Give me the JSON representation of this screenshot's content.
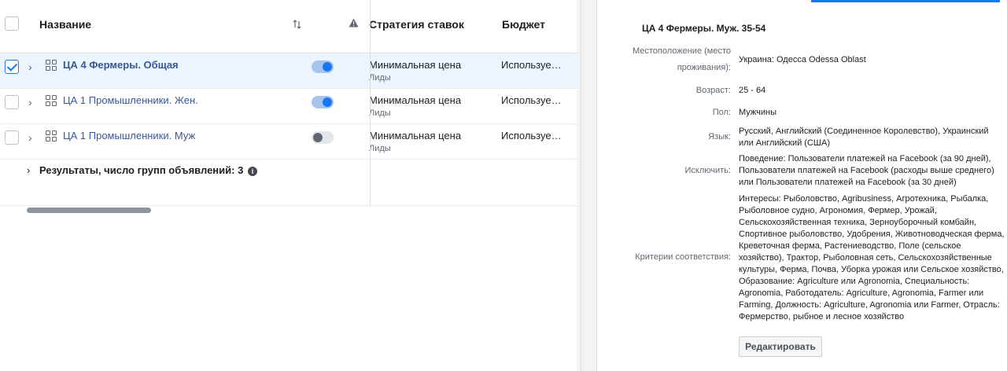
{
  "table": {
    "headers": {
      "name": "Название",
      "strategy": "Стратегия ставок",
      "budget": "Бюджет"
    },
    "rows": [
      {
        "name": "ЦА 4 Фермеры. Общая",
        "toggle_on": true,
        "strategy": "Минимальная цена",
        "strategy_sub": "Лиды",
        "budget": "Используе…",
        "selected": true
      },
      {
        "name": "ЦА 1 Промышленники. Жен.",
        "toggle_on": true,
        "strategy": "Минимальная цена",
        "strategy_sub": "Лиды",
        "budget": "Используе…",
        "selected": false
      },
      {
        "name": "ЦА 1 Промышленники. Муж",
        "toggle_on": false,
        "strategy": "Минимальная цена",
        "strategy_sub": "Лиды",
        "budget": "Используе…",
        "selected": false
      }
    ],
    "summary": "Результаты, число групп объявлений: 3"
  },
  "icons": {
    "sort": "sort-arrows-icon",
    "warning": "warning-icon",
    "expand": "chevron-right-icon",
    "adset": "grid-icon",
    "info": "info-icon"
  },
  "colors": {
    "accent": "#1877f2",
    "link": "#385898",
    "selected_row": "#ebf5ff"
  },
  "audience": {
    "title": "ЦА 4 Фермеры. Муж. 35-54",
    "location_label_1": "Местоположение (место",
    "location_label_2": "проживания):",
    "location_value": "Украина: Одесса Odessa Oblast",
    "age_label": "Возраст:",
    "age_value": "25 - 64",
    "gender_label": "Пол:",
    "gender_value": "Мужчины",
    "language_label": "Язык:",
    "language_value": "Русский, Английский (Соединенное Королевство), Украинский или Английский (США)",
    "exclude_label": "Исключить:",
    "exclude_value": "Поведение: Пользователи платежей на Facebook (за 90 дней), Пользователи платежей на Facebook (расходы выше среднего) или Пользователи платежей на Facebook (за 30 дней)",
    "criteria_label": "Критерии соответствия:",
    "criteria_value": "Интересы: Рыболовство, Agribusiness, Агротехника, Рыбалка, Рыболовное судно, Агрономия, Фермер, Урожай, Сельскохозяйственная техника, Зерноуборочный комбайн, Спортивное рыболовство, Удобрения, Животноводческая ферма, Креветочная ферма, Растениеводство, Поле (сельское хозяйство), Трактор, Рыболовная сеть, Сельскохозяйственные культуры, Ферма, Почва, Уборка урожая или Сельское хозяйство, Образование: Agriculture или Agronomia, Специальность: Agronomia, Работодатель: Agriculture, Agronomia, Farmer или Farming, Должность: Agriculture, Agronomia или Farmer, Отрасль: Фермерство, рыбное и лесное хозяйство",
    "edit_button": "Редактировать"
  }
}
